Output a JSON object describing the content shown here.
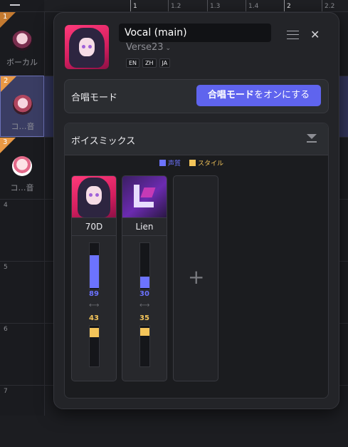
{
  "tracks": [
    {
      "num": "1",
      "label": "ボーカル"
    },
    {
      "num": "2",
      "label": "コ…音"
    },
    {
      "num": "3",
      "label": "コ…音"
    },
    {
      "num": "4"
    },
    {
      "num": "5"
    },
    {
      "num": "6"
    },
    {
      "num": "7"
    }
  ],
  "ruler": [
    "1",
    "1.2",
    "1.3",
    "1.4",
    "2",
    "2.2"
  ],
  "panel": {
    "vocal_name": "Vocal (main)",
    "style_name": "Verse23",
    "languages": [
      "EN",
      "ZH",
      "JA"
    ],
    "chorus": {
      "label": "合唱モード",
      "button_bold": "合唱モード",
      "button_rest": "をオンにする"
    },
    "voice_mix": {
      "title": "ボイスミックス",
      "legend": {
        "voice": "声質",
        "style": "スタイル"
      },
      "voices": [
        {
          "name": "70D",
          "voice_value": 89,
          "style_value": 43
        },
        {
          "name": "Lien",
          "voice_value": 30,
          "style_value": 35
        }
      ]
    }
  },
  "colors": {
    "accent": "#5f64ee",
    "voice": "#6c73ff",
    "style": "#f4c55a"
  }
}
